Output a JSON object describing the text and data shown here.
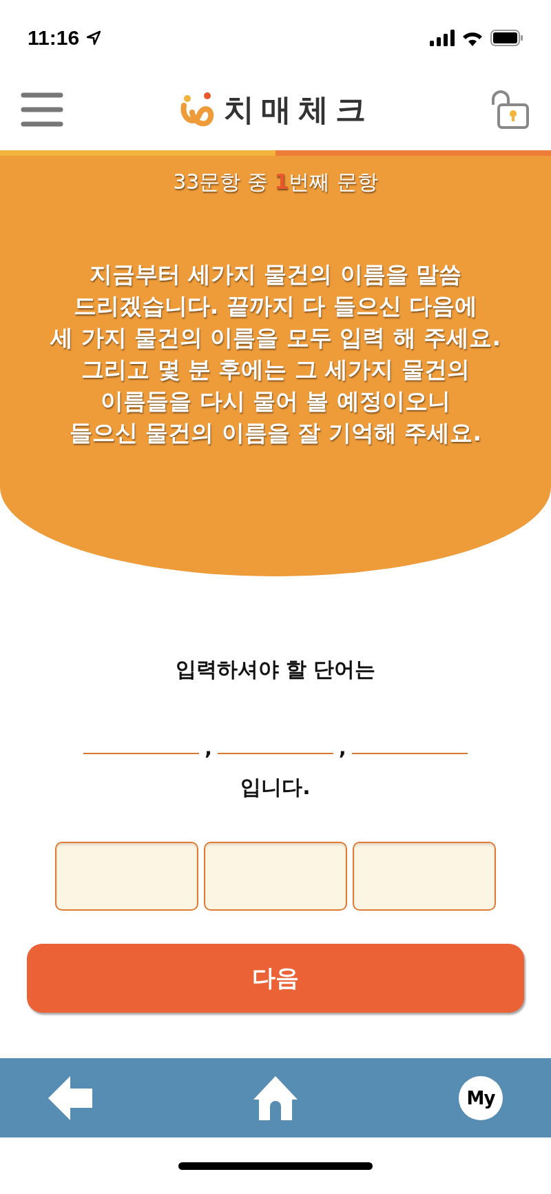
{
  "status_bar": {
    "time": "11:16"
  },
  "header": {
    "title": "치매체크"
  },
  "progress": {
    "level": 0.5,
    "label": "33문항 중 **1**번째 문항"
  },
  "instruction": "지금부터 세가지 물건의 이름을 말씀\n드리겠습니다. 끝까지 다 들으신 다음에\n세 가지 물건의 이름을 모두 입력 해 주세요.\n그리고 몇 분 후에는 그 세가지 물건의\n이름들을 다시 물어 볼 예정이오니\n들으신 물건의 이름을 잘 기억해 주세요.",
  "prompt": "입력하셔야 할 단어는",
  "blanks": [
    {
      "kind": "line"
    },
    {
      "kind": "separator",
      "text": ","
    },
    {
      "kind": "line"
    },
    {
      "kind": "separator",
      "text": ","
    },
    {
      "kind": "line"
    }
  ],
  "prompt_end": "입니다.",
  "answer_fields": [
    {
      "filled": false
    },
    {
      "filled": false
    },
    {
      "filled": false
    }
  ],
  "next_button": "다음",
  "bottom_nav": [
    {
      "kind": "back"
    },
    {
      "kind": "home"
    },
    {
      "kind": "my",
      "label": "My"
    }
  ]
}
